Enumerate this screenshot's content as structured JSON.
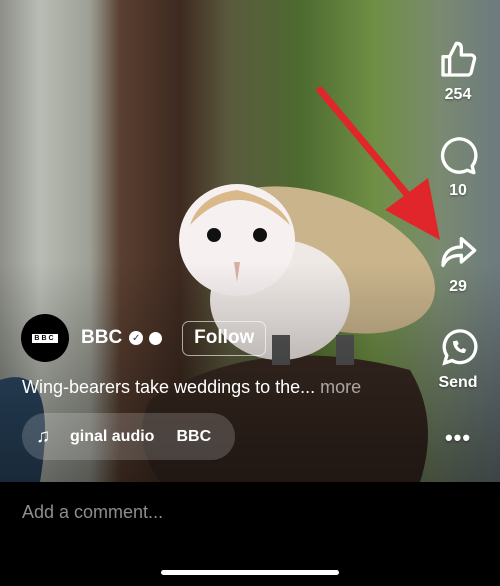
{
  "actions": {
    "like_count": "254",
    "comment_count": "10",
    "share_count": "29",
    "send_label": "Send"
  },
  "post": {
    "account": "BBC",
    "avatar_text": "BBC",
    "follow_label": "Follow",
    "caption": "Wing-bearers take weddings to the...",
    "more_label": "more",
    "audio_label": "ginal audio",
    "audio_artist": "BBC"
  },
  "comment": {
    "placeholder": "Add a comment..."
  },
  "colors": {
    "arrow": "#e0262a",
    "background": "#000000"
  }
}
